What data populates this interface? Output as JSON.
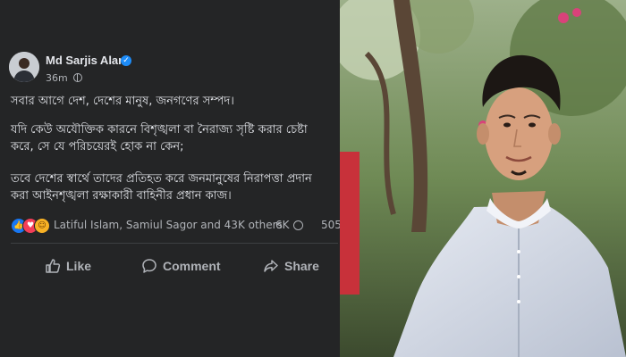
{
  "post": {
    "author_name": "Md Sarjis Alam",
    "time": "36m",
    "paragraphs": [
      "সবার আগে দেশ, দেশের মানুষ, জনগণের সম্পদ।",
      "যদি কেউ অযৌক্তিক কারনে বিশৃঙ্খলা বা নৈরাজ্য সৃষ্টি করার চেষ্টা করে, সে যে পরিচয়েরই হোক না কেন;",
      "তবে দেশের স্বার্থে তাদের প্রতিহত করে জনমানুষের নিরাপত্তা প্রদান করা আইনশৃঙ্খলা রক্ষাকারী বাহিনীর প্রধান কাজ।"
    ],
    "reactors": "Latiful Islam, Samiul Sagor and 43K others",
    "comments_count": "6K",
    "shares_count": "505",
    "actions": {
      "like": "Like",
      "comment": "Comment",
      "share": "Share"
    }
  },
  "colors": {
    "background": "#242526",
    "text": "#e4e6eb",
    "secondary_text": "#b0b3b8",
    "verified": "#1d8cf8",
    "like": "#1877f2",
    "love": "#f33e58",
    "care": "#f7b125"
  },
  "icons": [
    "verified-badge-icon",
    "globe-icon",
    "like-reaction-icon",
    "love-reaction-icon",
    "care-reaction-icon",
    "comment-icon",
    "share-icon",
    "thumbs-up-icon"
  ]
}
